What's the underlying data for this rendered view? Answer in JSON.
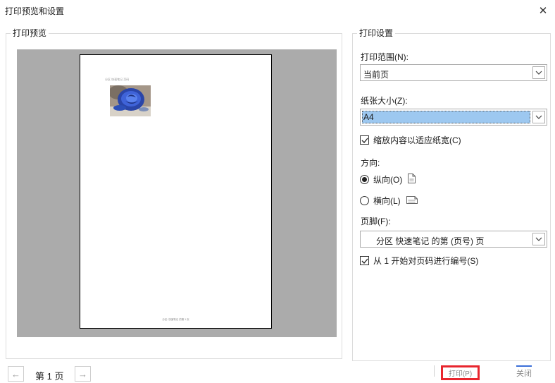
{
  "window": {
    "title": "打印预览和设置",
    "close_symbol": "✕"
  },
  "preview": {
    "group_label": "打印预览",
    "paper_header_text": "分区 快速笔记  页码",
    "paper_footer_text": "分区: 快速笔记 的第 1 页"
  },
  "settings": {
    "group_label": "打印设置",
    "print_range_label": "打印范围(N):",
    "print_range_value": "当前页",
    "paper_size_label": "纸张大小(Z):",
    "paper_size_value": "A4",
    "scale_to_width_label": "缩放内容以适应纸宽(C)",
    "scale_to_width_checked": true,
    "orientation_label": "方向:",
    "portrait_label": "纵向(O)",
    "landscape_label": "横向(L)",
    "orientation_selected": "portrait",
    "footer_label": "页脚(F):",
    "footer_value": "分区 快速笔记 的第 (页号) 页",
    "number_from_one_label": "从 1 开始对页码进行编号(S)",
    "number_from_one_checked": true
  },
  "bottom": {
    "prev_symbol": "←",
    "next_symbol": "→",
    "page_indicator": "第 1 页",
    "print_button": "打印(P)",
    "close_button": "关闭"
  },
  "colors": {
    "highlight": "#9dc8f0",
    "print_button_border": "#e8262e",
    "preview_background": "#ababab"
  }
}
